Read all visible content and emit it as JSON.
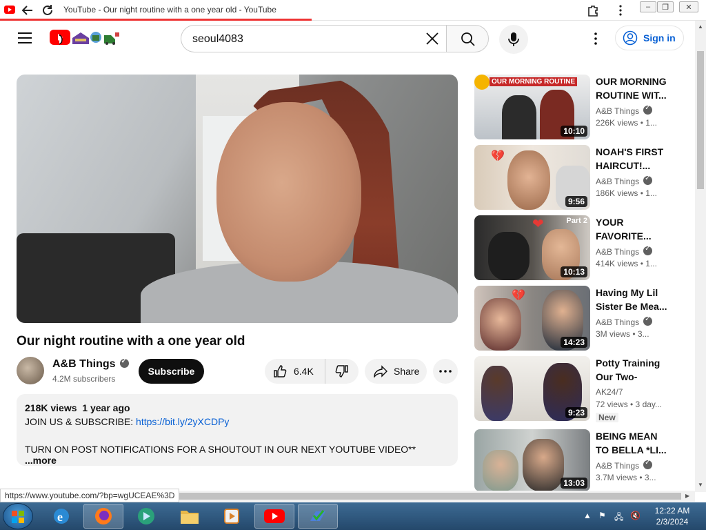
{
  "browser": {
    "tab_title": "YouTube - Our night routine with a one year old - YouTube",
    "status_url": "https://www.youtube.com/?bp=wgUCEAE%3D"
  },
  "header": {
    "search_value": "seoul4083",
    "sign_in_label": "Sign in"
  },
  "video": {
    "title": "Our night routine with a one year old",
    "channel": "A&B Things",
    "subscribers": "4.2M subscribers",
    "subscribe_label": "Subscribe",
    "likes": "6.4K",
    "share_label": "Share",
    "views": "218K views",
    "age": "1 year ago",
    "desc_line1_prefix": "JOIN US & SUBSCRIBE: ",
    "desc_link": "https://bit.ly/2yXCDPy",
    "desc_line2": "TURN ON POST NOTIFICATIONS FOR A SHOUTOUT IN OUR NEXT YOUTUBE VIDEO**",
    "more_label": "...more"
  },
  "recommendations": [
    {
      "title": "OUR MORNING ROUTINE WIT...",
      "channel": "A&B Things",
      "views": "226K views • 1...",
      "duration": "10:10",
      "thumb_caption": "OUR MORNING ROUTINE"
    },
    {
      "title": "NOAH'S FIRST HAIRCUT!...",
      "channel": "A&B Things",
      "views": "186K views • 1...",
      "duration": "9:56"
    },
    {
      "title": "YOUR FAVORITE...",
      "channel": "A&B Things",
      "views": "414K views • 1...",
      "duration": "10:13",
      "thumb_caption": "Part 2"
    },
    {
      "title": "Having My Lil Sister Be Mea...",
      "channel": "A&B Things",
      "views": "3M views • 3...",
      "duration": "14:23"
    },
    {
      "title": "Potty Training Our Two-Year-...",
      "channel": "AK24/7",
      "views": "72 views • 3 day...",
      "duration": "9:23",
      "badge": "New"
    },
    {
      "title": "BEING MEAN TO BELLA *LI...",
      "channel": "A&B Things",
      "views": "3.7M views • 3...",
      "duration": "13:03"
    }
  ],
  "taskbar": {
    "time": "12:22 AM",
    "date": "2/3/2024"
  },
  "colors": {
    "youtube_red": "#ff0000",
    "link_blue": "#065fd4",
    "subscribe_bg": "#0f0f0f"
  }
}
